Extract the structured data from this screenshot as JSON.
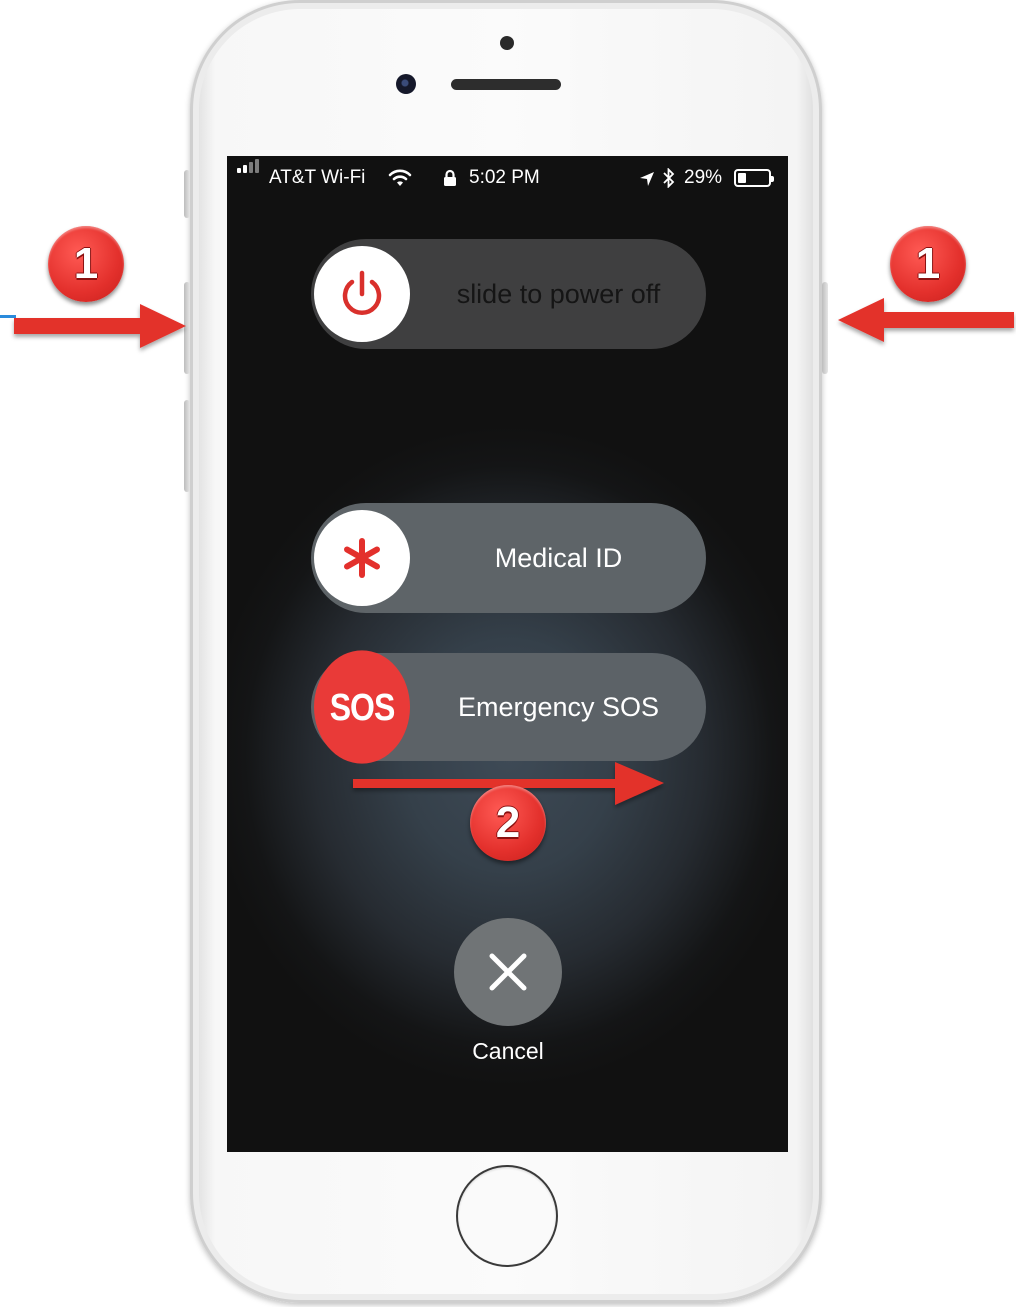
{
  "status_bar": {
    "carrier": "AT&T Wi-Fi",
    "time": "5:02 PM",
    "battery_percent": "29%",
    "battery_level": 0.29
  },
  "power_slider": {
    "label": "slide to power off"
  },
  "medical_slider": {
    "label": "Medical ID"
  },
  "sos_slider": {
    "knob_text": "SOS",
    "label": "Emergency SOS"
  },
  "cancel": {
    "label": "Cancel"
  },
  "annotations": {
    "step_left": "1",
    "step_right": "1",
    "step_slide": "2",
    "color": "#e3302c"
  }
}
